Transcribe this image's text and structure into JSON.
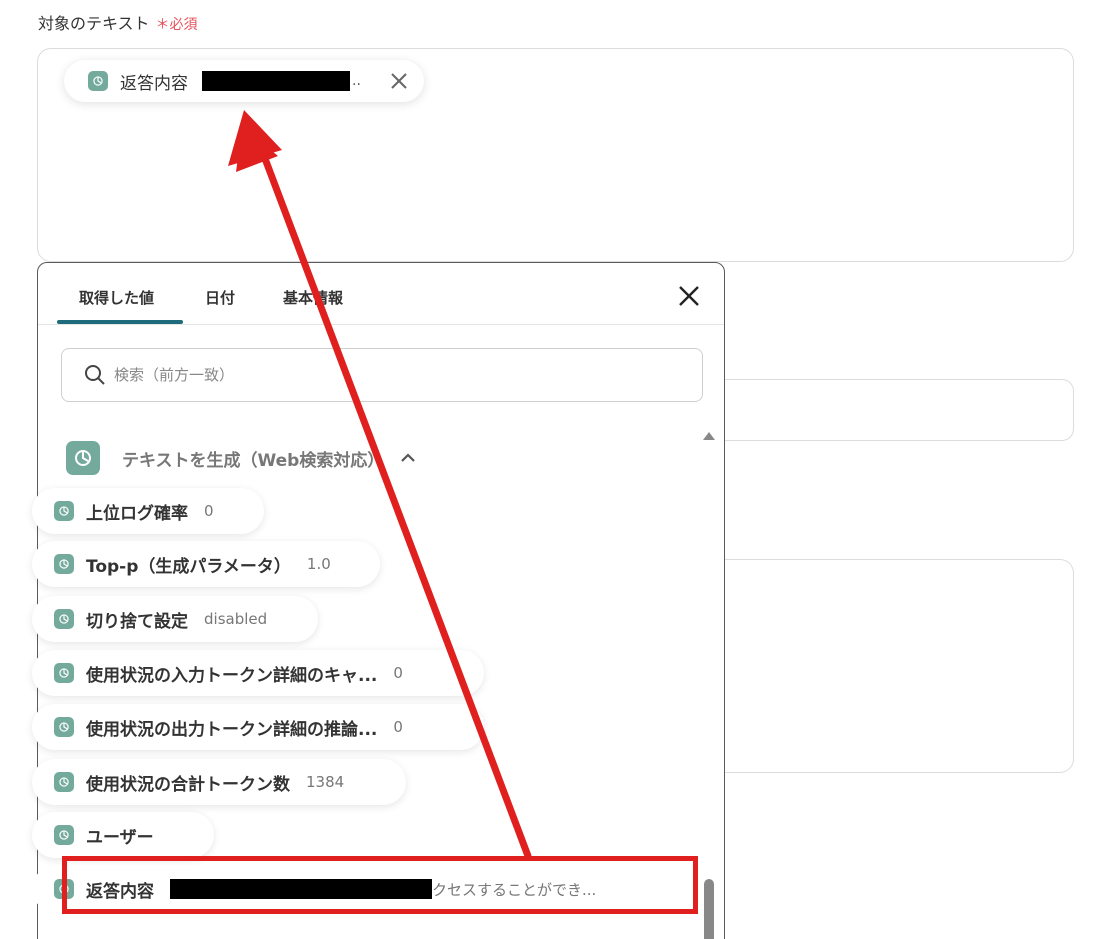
{
  "field": {
    "label": "対象のテキスト",
    "required_mark": "＊必須"
  },
  "chip": {
    "label": "返答内容",
    "ellipsis": "..",
    "icon": "openai-icon",
    "remove_icon": "close-icon"
  },
  "panel": {
    "tabs": [
      {
        "label": "取得した値",
        "active": true
      },
      {
        "label": "日付",
        "active": false
      },
      {
        "label": "基本情報",
        "active": false
      }
    ],
    "close_icon": "close-icon",
    "search": {
      "placeholder": "検索（前方一致）",
      "value": "",
      "icon": "search-icon"
    },
    "group": {
      "title": "テキストを生成（Web検索対応）",
      "expanded": true,
      "icon": "openai-icon"
    },
    "items": [
      {
        "name": "上位ログ確率",
        "value": "0"
      },
      {
        "name": "Top-p（生成パラメータ）",
        "value": "1.0"
      },
      {
        "name": "切り捨て設定",
        "value": "disabled"
      },
      {
        "name": "使用状況の入力トークン詳細のキャ...",
        "value": "0"
      },
      {
        "name": "使用状況の出力トークン詳細の推論...",
        "value": "0"
      },
      {
        "name": "使用状況の合計トークン数",
        "value": "1384"
      },
      {
        "name": "ユーザー",
        "value": ""
      },
      {
        "name": "返答内容",
        "value": "クセスすることができ..."
      }
    ]
  },
  "colors": {
    "accent_tab": "#1e6b7b",
    "required": "#e8505b",
    "annotation_red": "#e0201e",
    "openai_green": "#74aa9c"
  }
}
